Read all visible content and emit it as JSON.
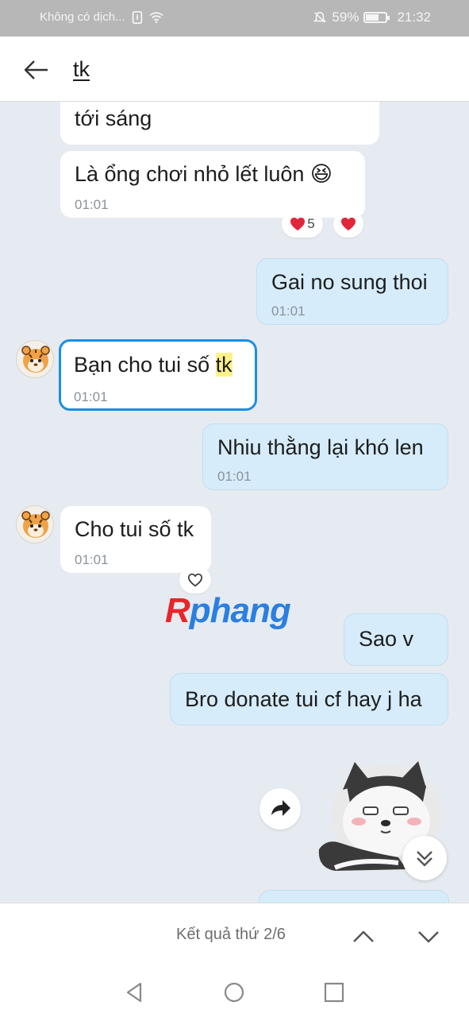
{
  "status_bar": {
    "carrier": "Không có dịch...",
    "battery": "59%",
    "battery_level": 0.59,
    "time": "21:32"
  },
  "header": {
    "title": "tk"
  },
  "messages": [
    {
      "direction": "in",
      "text": "tới sáng",
      "time": ""
    },
    {
      "direction": "in",
      "text": "Là ổng chơi nhỏ lết luôn 😆",
      "time": "01:01",
      "reaction_count": "5"
    },
    {
      "direction": "out",
      "text": "Gai no sung thoi",
      "time": "01:01"
    },
    {
      "direction": "in",
      "text_before": "Bạn cho tui số ",
      "highlight": "tk",
      "time": "01:01"
    },
    {
      "direction": "out",
      "text": "Nhiu thằng lại khó len",
      "time": "01:01"
    },
    {
      "direction": "in",
      "text": "Cho tui số tk",
      "time": "01:01"
    },
    {
      "direction": "out",
      "text": "Sao v"
    },
    {
      "direction": "out",
      "text": "Bro donate tui cf hay j ha"
    }
  ],
  "watermark": {
    "first": "R",
    "rest": "phang"
  },
  "search": {
    "result_text": "Kết quả thứ 2/6"
  },
  "icons": {
    "back": "back-arrow-icon",
    "heart": "heart-icon",
    "forward": "forward-icon",
    "scroll_down": "double-chevron-down-icon",
    "up": "chevron-up-icon",
    "down": "chevron-down-icon"
  },
  "colors": {
    "accent": "#1a8fe0",
    "outgoing_bubble": "#d6ecfa",
    "incoming_bubble": "#ffffff",
    "chat_background": "#e6ebf1",
    "highlight": "#fdf28a",
    "heart": "#e2263a"
  }
}
